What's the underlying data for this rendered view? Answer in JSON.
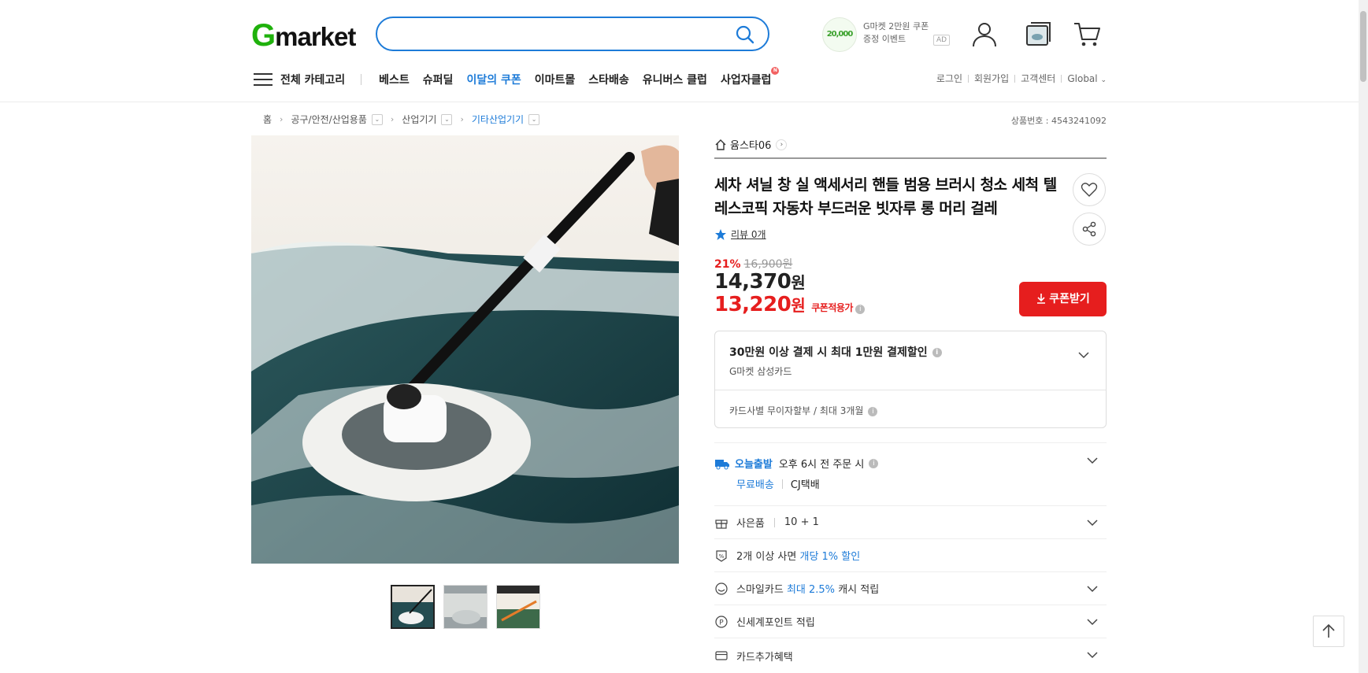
{
  "header": {
    "logo": {
      "g": "G",
      "rest": "market"
    },
    "search": {
      "placeholder": ""
    },
    "promo": {
      "coin": "20,000",
      "line1": "G마켓 2만원 쿠폰",
      "line2": "증정 이벤트",
      "ad": "AD"
    }
  },
  "nav": {
    "all_categories": "전체 카테고리",
    "items": [
      "베스트",
      "슈퍼딜",
      "이달의 쿠폰",
      "이마트몰",
      "스타배송",
      "유니버스 클럽",
      "사업자클럽"
    ],
    "badge": "N",
    "util": [
      "로그인",
      "회원가입",
      "고객센터",
      "Global"
    ]
  },
  "breadcrumb": [
    "홈",
    "공구/안전/산업용품",
    "산업기기",
    "기타산업기기"
  ],
  "product_number": "상품번호 : 4543241092",
  "seller": "윰스타06",
  "product": {
    "title": "세차 셔닐 창 실 액세서리 핸들 범용 브러시 청소 세척 텔레스코픽 자동차 부드러운 빗자루 롱 머리 걸레",
    "review": "리뷰 0개",
    "discount_pct": "21%",
    "original_price": "16,900원",
    "price_num": "14,370",
    "price_unit": "원",
    "coupon_price_num": "13,220",
    "coupon_price_unit": "원",
    "coupon_tag": "쿠폰적용가",
    "coupon_button": "쿠폰받기"
  },
  "card_benefit": {
    "title": "30만원 이상 결제 시 최대 1만원 결제할인",
    "card": "G마켓 삼성카드",
    "installment": "카드사별 무이자할부 / 최대 3개월"
  },
  "shipping": {
    "today_label": "오늘출발",
    "cutoff": "오후 6시 전 주문 시",
    "free": "무료배송",
    "carrier": "CJ택배"
  },
  "rows": {
    "gift_label": "사은품",
    "gift_value": "10 + 1",
    "multi_prefix": "2개 이상 사면",
    "multi_blue": "개당 1% 할인",
    "smile_prefix": "스마일카드",
    "smile_blue": "최대 2.5%",
    "smile_suffix": "캐시 적립",
    "point": "신세계포인트 적립",
    "card_extra": "카드추가혜택"
  },
  "colors": {
    "accent": "#1d7bd8",
    "sale": "#e61e1e",
    "brand_green": "#1fb10c"
  }
}
